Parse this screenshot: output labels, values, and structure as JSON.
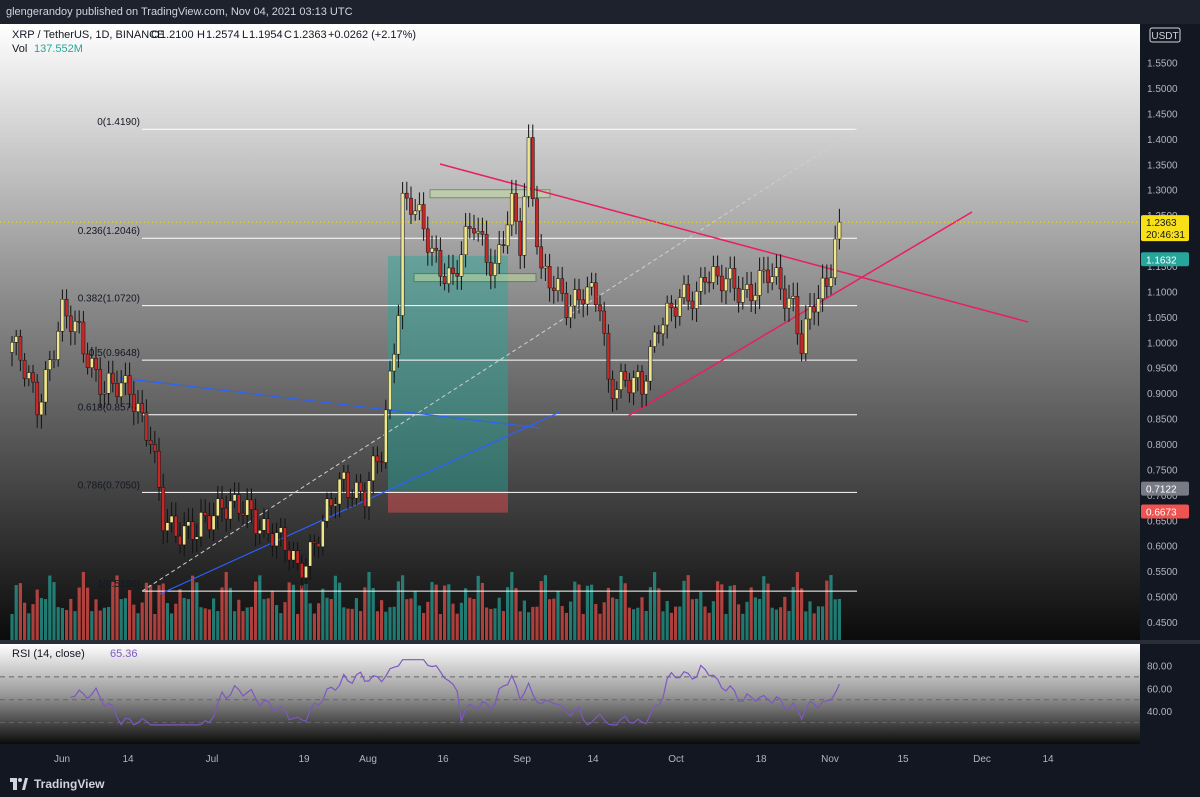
{
  "header": {
    "published": "glengerandoy published on TradingView.com, Nov 04, 2021 03:13 UTC"
  },
  "legend": {
    "symbol": "XRP / TetherUS, 1D, BINANCE",
    "o_label": "O",
    "o_value": "1.2100",
    "h_label": "H",
    "h_value": "1.2574",
    "l_label": "L",
    "l_value": "1.1954",
    "c_label": "C",
    "c_value": "1.2363",
    "change": "+0.0262 (+2.17%)",
    "vol_label": "Vol",
    "vol_value": "137.552M",
    "currency": "USDT"
  },
  "rsi": {
    "label": "RSI (14, close)",
    "value": "65.36",
    "color": "#7e57c2"
  },
  "brand": {
    "name": "TradingView"
  },
  "colors": {
    "up": "#f0e68c",
    "down": "#c62828",
    "vol_up": "#26a69a",
    "vol_down": "#ef5350",
    "triangle": "#e91e63",
    "trend": "#2962ff",
    "fib": "#ffffff",
    "last_price": "#f7e017"
  },
  "chart_data": {
    "type": "candlestick",
    "x_ticks": [
      "Jun",
      "14",
      "Jul",
      "19",
      "Aug",
      "16",
      "Sep",
      "14",
      "Oct",
      "18",
      "Nov",
      "15",
      "Dec",
      "14"
    ],
    "y_ticks": [
      "1.5500",
      "1.5000",
      "1.4500",
      "1.4000",
      "1.3500",
      "1.3000",
      "1.2500",
      "1.1500",
      "1.1000",
      "1.0500",
      "1.0000",
      "0.9500",
      "0.9000",
      "0.8500",
      "0.8000",
      "0.7500",
      "0.7000",
      "0.6500",
      "0.6000",
      "0.5500",
      "0.5000",
      "0.4500"
    ],
    "rsi_ticks": [
      "80.00",
      "60.00",
      "40.00"
    ],
    "fib_levels": [
      {
        "label": "0(1.4190)",
        "value": 1.419
      },
      {
        "label": "0.236(1.2046)",
        "value": 1.2046
      },
      {
        "label": "0.382(1.0720)",
        "value": 1.072
      },
      {
        "label": "0.5(0.9648)",
        "value": 0.9648
      },
      {
        "label": "0.618(0.8576)",
        "value": 0.8576
      },
      {
        "label": "0.786(0.7050)",
        "value": 0.705
      },
      {
        "label": "1(0.5106)",
        "value": 0.5106
      }
    ],
    "price_badges": [
      {
        "label": "1.2363",
        "sub": "20:46:31",
        "value": 1.2363,
        "bg": "#f7e017",
        "fg": "#131722"
      },
      {
        "label": "1.1632",
        "value": 1.1632,
        "bg": "#26a69a",
        "fg": "#ffffff"
      },
      {
        "label": "0.7122",
        "value": 0.7122,
        "bg": "#787b86",
        "fg": "#ffffff"
      },
      {
        "label": "0.6673",
        "value": 0.6673,
        "bg": "#ef5350",
        "fg": "#ffffff"
      }
    ],
    "keypoints": [
      [
        0,
        1.0
      ],
      [
        6,
        0.88
      ],
      [
        12,
        1.05
      ],
      [
        16,
        1.02
      ],
      [
        22,
        0.9
      ],
      [
        28,
        0.92
      ],
      [
        33,
        0.8
      ],
      [
        36,
        0.65
      ],
      [
        44,
        0.62
      ],
      [
        50,
        0.69
      ],
      [
        58,
        0.65
      ],
      [
        62,
        0.63
      ],
      [
        66,
        0.58
      ],
      [
        68,
        0.55
      ],
      [
        74,
        0.64
      ],
      [
        79,
        0.73
      ],
      [
        84,
        0.7
      ],
      [
        88,
        0.78
      ],
      [
        92,
        1.08
      ],
      [
        93,
        1.28
      ],
      [
        95,
        1.27
      ],
      [
        100,
        1.18
      ],
      [
        105,
        1.12
      ],
      [
        110,
        1.24
      ],
      [
        115,
        1.14
      ],
      [
        119,
        1.26
      ],
      [
        121,
        1.2
      ],
      [
        123,
        1.39
      ],
      [
        124,
        1.3
      ],
      [
        126,
        1.13
      ],
      [
        132,
        1.08
      ],
      [
        136,
        1.1
      ],
      [
        140,
        1.07
      ],
      [
        142,
        0.92
      ],
      [
        146,
        0.93
      ],
      [
        150,
        0.9
      ],
      [
        154,
        1.05
      ],
      [
        158,
        1.07
      ],
      [
        163,
        1.09
      ],
      [
        165,
        1.15
      ],
      [
        168,
        1.12
      ],
      [
        174,
        1.1
      ],
      [
        180,
        1.13
      ],
      [
        186,
        1.08
      ],
      [
        188,
        1.0
      ],
      [
        191,
        1.07
      ],
      [
        194,
        1.11
      ],
      [
        196,
        1.21
      ],
      [
        197,
        1.2363
      ]
    ]
  }
}
